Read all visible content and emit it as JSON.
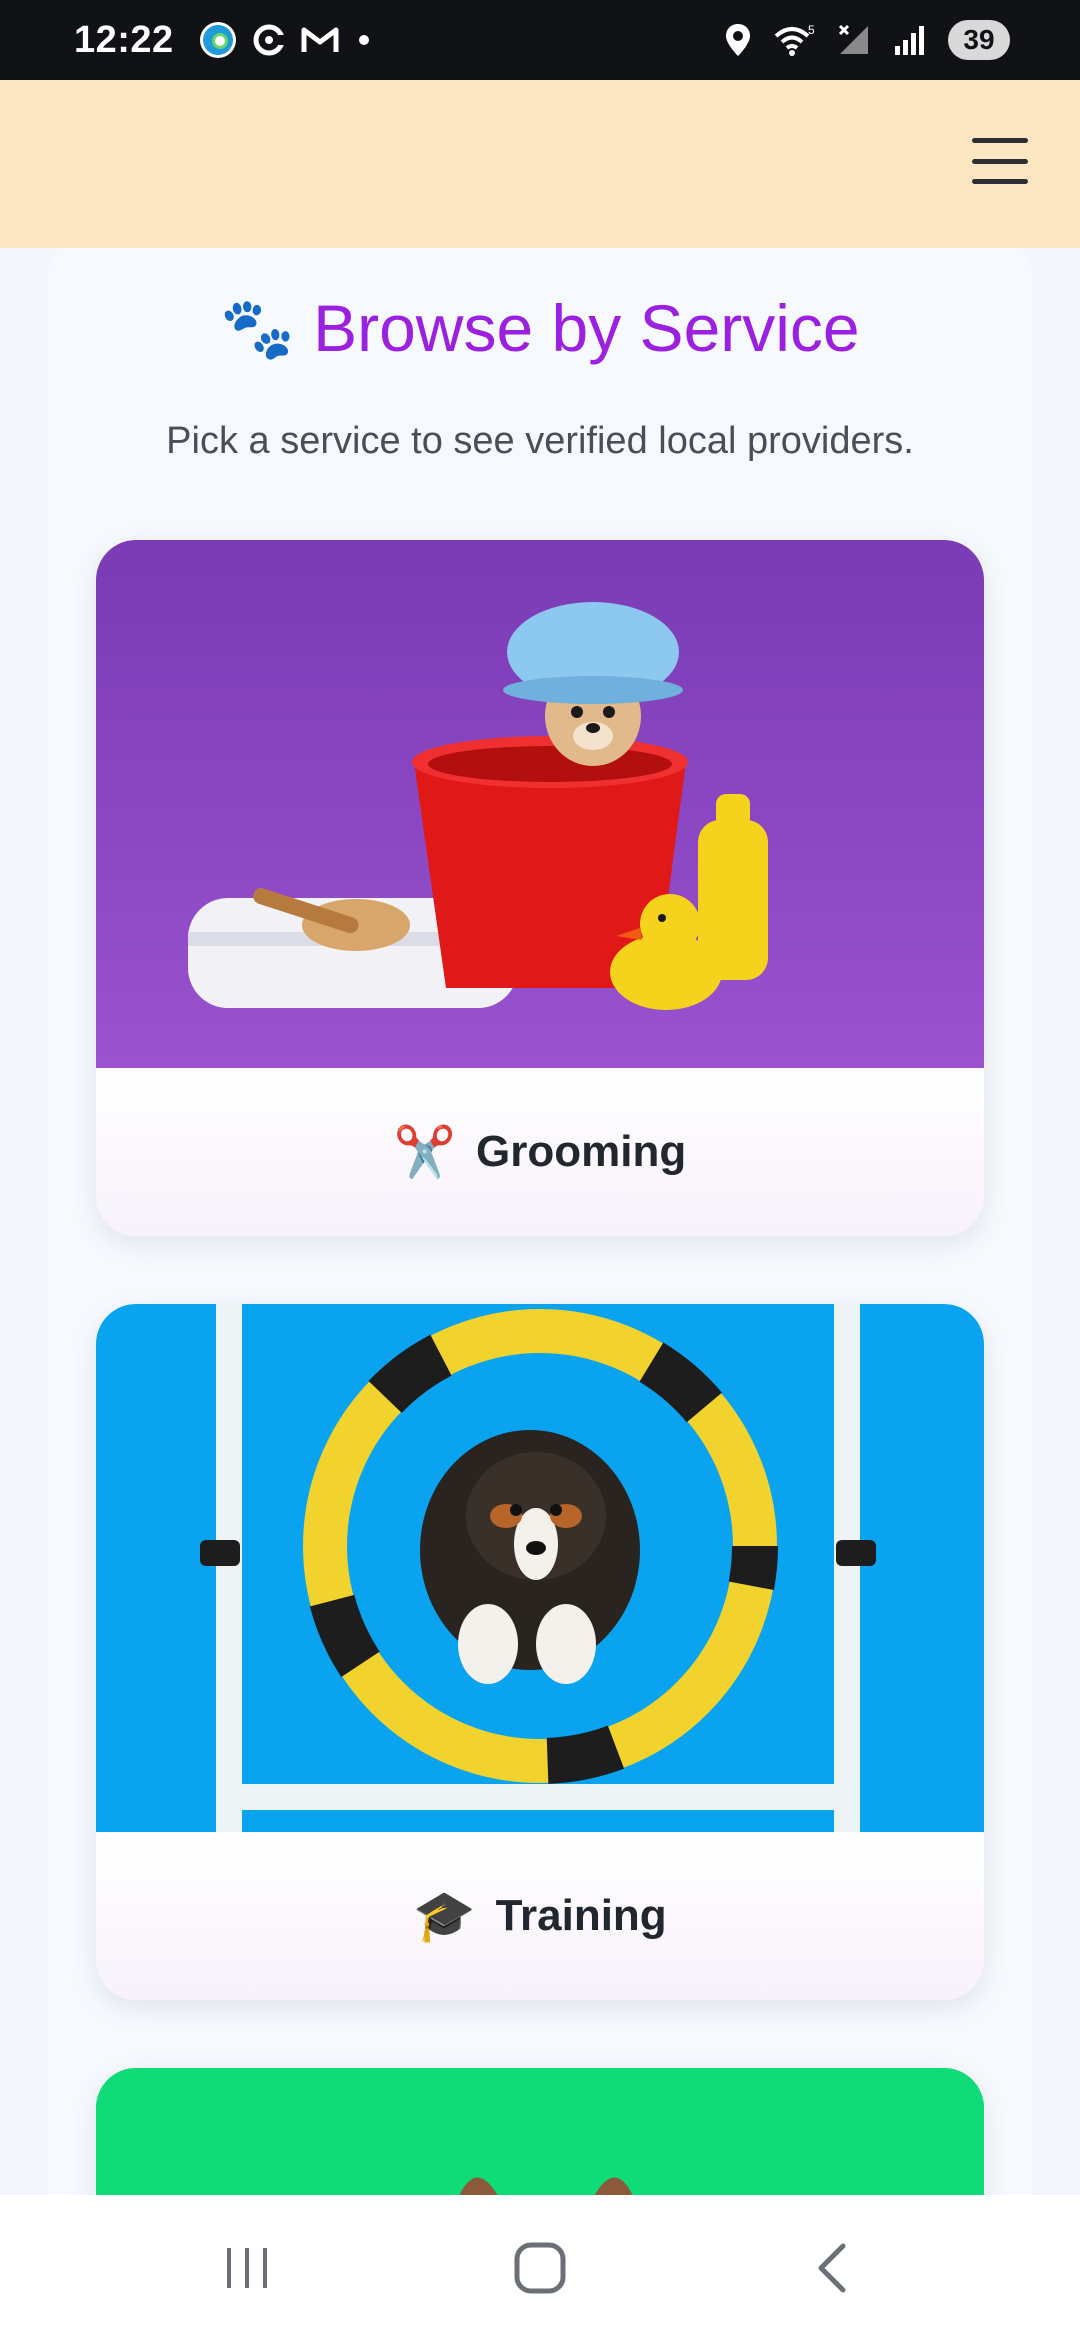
{
  "status_bar": {
    "time": "12:22",
    "battery": "39",
    "icons": [
      "edge-icon",
      "c-app-icon",
      "gmail-icon",
      "dot-icon",
      "location-icon",
      "wifi-icon",
      "no-signal-icon",
      "signal-icon",
      "battery-icon"
    ]
  },
  "header": {
    "menu_icon": "hamburger-menu-icon"
  },
  "browse": {
    "title_icon": "🐾",
    "title": "Browse by Service",
    "subtitle": "Pick a service to see verified local providers.",
    "title_color": "#9c20e0"
  },
  "services": [
    {
      "icon": "✂️",
      "label": "Grooming",
      "image": "grooming-photo",
      "image_bg": "#8a3fc0"
    },
    {
      "icon": "🎓",
      "label": "Training",
      "image": "training-photo",
      "image_bg": "#0aa3f0"
    },
    {
      "icon": "",
      "label": "",
      "image": "service-photo",
      "image_bg": "#0fdc79"
    }
  ],
  "nav": {
    "recents": "recents-icon",
    "home": "home-icon",
    "back": "back-icon"
  },
  "colors": {
    "header_bg": "#fde7c2",
    "status_bg": "#101216"
  }
}
